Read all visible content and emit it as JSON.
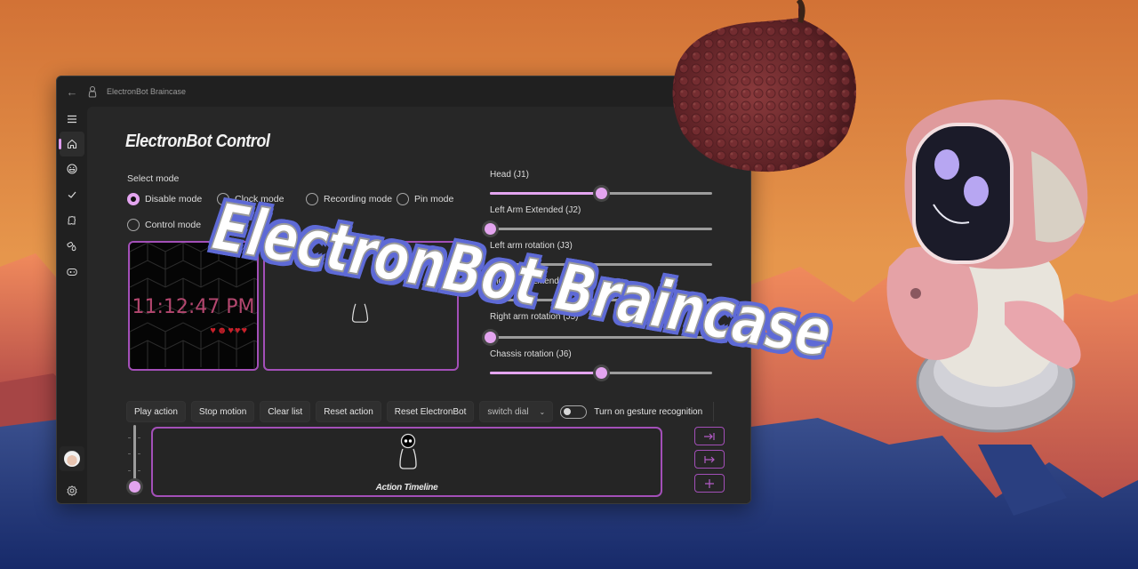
{
  "window": {
    "title": "ElectronBot Braincase"
  },
  "sidebar": {
    "items": [
      {
        "name": "menu",
        "icon": "hamburger-icon",
        "active": false
      },
      {
        "name": "home",
        "icon": "home-icon",
        "active": true
      },
      {
        "name": "emoji",
        "icon": "emoji-icon",
        "active": false
      },
      {
        "name": "tasks",
        "icon": "checkmark-icon",
        "active": false
      },
      {
        "name": "puzzle",
        "icon": "puzzle-icon",
        "active": false
      },
      {
        "name": "shapes",
        "icon": "shapes-icon",
        "active": false
      },
      {
        "name": "game",
        "icon": "gamepad-icon",
        "active": false
      }
    ],
    "footer": [
      {
        "name": "account",
        "icon": "avatar"
      },
      {
        "name": "settings",
        "icon": "gear-icon"
      }
    ]
  },
  "page": {
    "title": "ElectronBot Control",
    "select_mode_label": "Select mode",
    "modes": [
      {
        "label": "Disable mode",
        "checked": true
      },
      {
        "label": "Clock mode",
        "checked": false
      },
      {
        "label": "Recording mode",
        "checked": false
      },
      {
        "label": "Pin mode",
        "checked": false
      },
      {
        "label": "Control mode",
        "checked": false
      }
    ],
    "clock": {
      "time": "11:12:47 PM",
      "hearts": "♥☻♥♥♥"
    }
  },
  "joints": [
    {
      "label": "Head (J1)",
      "value": 0.5
    },
    {
      "label": "Left Arm Extended (J2)",
      "value": 0.0
    },
    {
      "label": "Left arm rotation (J3)",
      "value": null
    },
    {
      "label": "Right Arm Extended (J4)",
      "value": null
    },
    {
      "label": "Right arm rotation (J5)",
      "value": 0.0
    },
    {
      "label": "Chassis rotation (J6)",
      "value": 0.5
    }
  ],
  "commands": {
    "buttons": [
      "Play action",
      "Stop motion",
      "Clear list",
      "Reset action",
      "Reset ElectronBot"
    ],
    "dropdown": {
      "value": "switch dial"
    },
    "gesture_toggle": {
      "label": "Turn on gesture recognition",
      "on": false
    }
  },
  "timeline": {
    "caption": "Action Timeline",
    "zoom_level": 0.0,
    "side_buttons": [
      {
        "name": "jump-to-end",
        "icon": "arrow-to-end-icon"
      },
      {
        "name": "jump-from-start",
        "icon": "arrow-from-start-icon"
      },
      {
        "name": "add",
        "icon": "plus-icon"
      }
    ]
  },
  "overlay": {
    "headline": "ElectronBot Braincase"
  },
  "colors": {
    "accent": "#e3a4ef",
    "panel_border": "#a34fb8",
    "headline_outline": "#5e6ad6",
    "clock_text": "#b4476f"
  }
}
